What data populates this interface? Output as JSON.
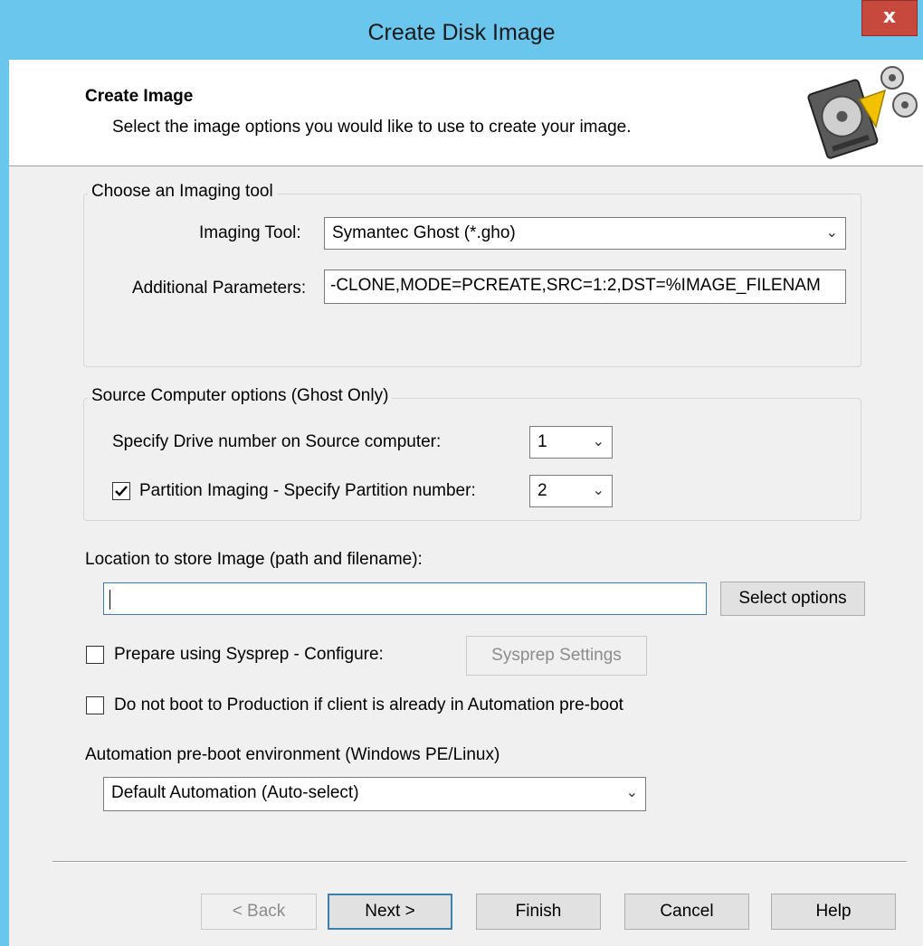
{
  "window": {
    "title": "Create Disk Image",
    "close_label": "x"
  },
  "header": {
    "title": "Create Image",
    "subtitle": "Select the image options you would like to use to create your image.",
    "icon": "disk-image-icon"
  },
  "imaging_tool_group": {
    "label": "Choose an Imaging tool",
    "tool_label": "Imaging Tool:",
    "tool_value": "Symantec Ghost (*.gho)",
    "params_label": "Additional Parameters:",
    "params_value": "-CLONE,MODE=PCREATE,SRC=1:2,DST=%IMAGE_FILENAM"
  },
  "source_group": {
    "label": "Source Computer options (Ghost Only)",
    "drive_label": "Specify Drive number on Source computer:",
    "drive_value": "1",
    "partition_checked": true,
    "partition_label": "Partition Imaging - Specify Partition number:",
    "partition_value": "2"
  },
  "location": {
    "label": "Location to store Image (path and filename):",
    "value": "",
    "select_button": "Select options"
  },
  "sysprep": {
    "checked": false,
    "label": "Prepare using Sysprep - Configure:",
    "settings_button": "Sysprep Settings"
  },
  "no_boot": {
    "checked": false,
    "label": "Do not boot to Production if client is already in Automation pre-boot"
  },
  "preboot": {
    "label": "Automation pre-boot environment (Windows PE/Linux)",
    "value": "Default Automation (Auto-select)"
  },
  "buttons": {
    "back": "< Back",
    "next": "Next >",
    "finish": "Finish",
    "cancel": "Cancel",
    "help": "Help"
  },
  "colors": {
    "title_bar": "#6bc6ee",
    "close_button": "#c7493e",
    "dialog_bg": "#f0f0f0",
    "default_button_border": "#3c7fb1"
  }
}
